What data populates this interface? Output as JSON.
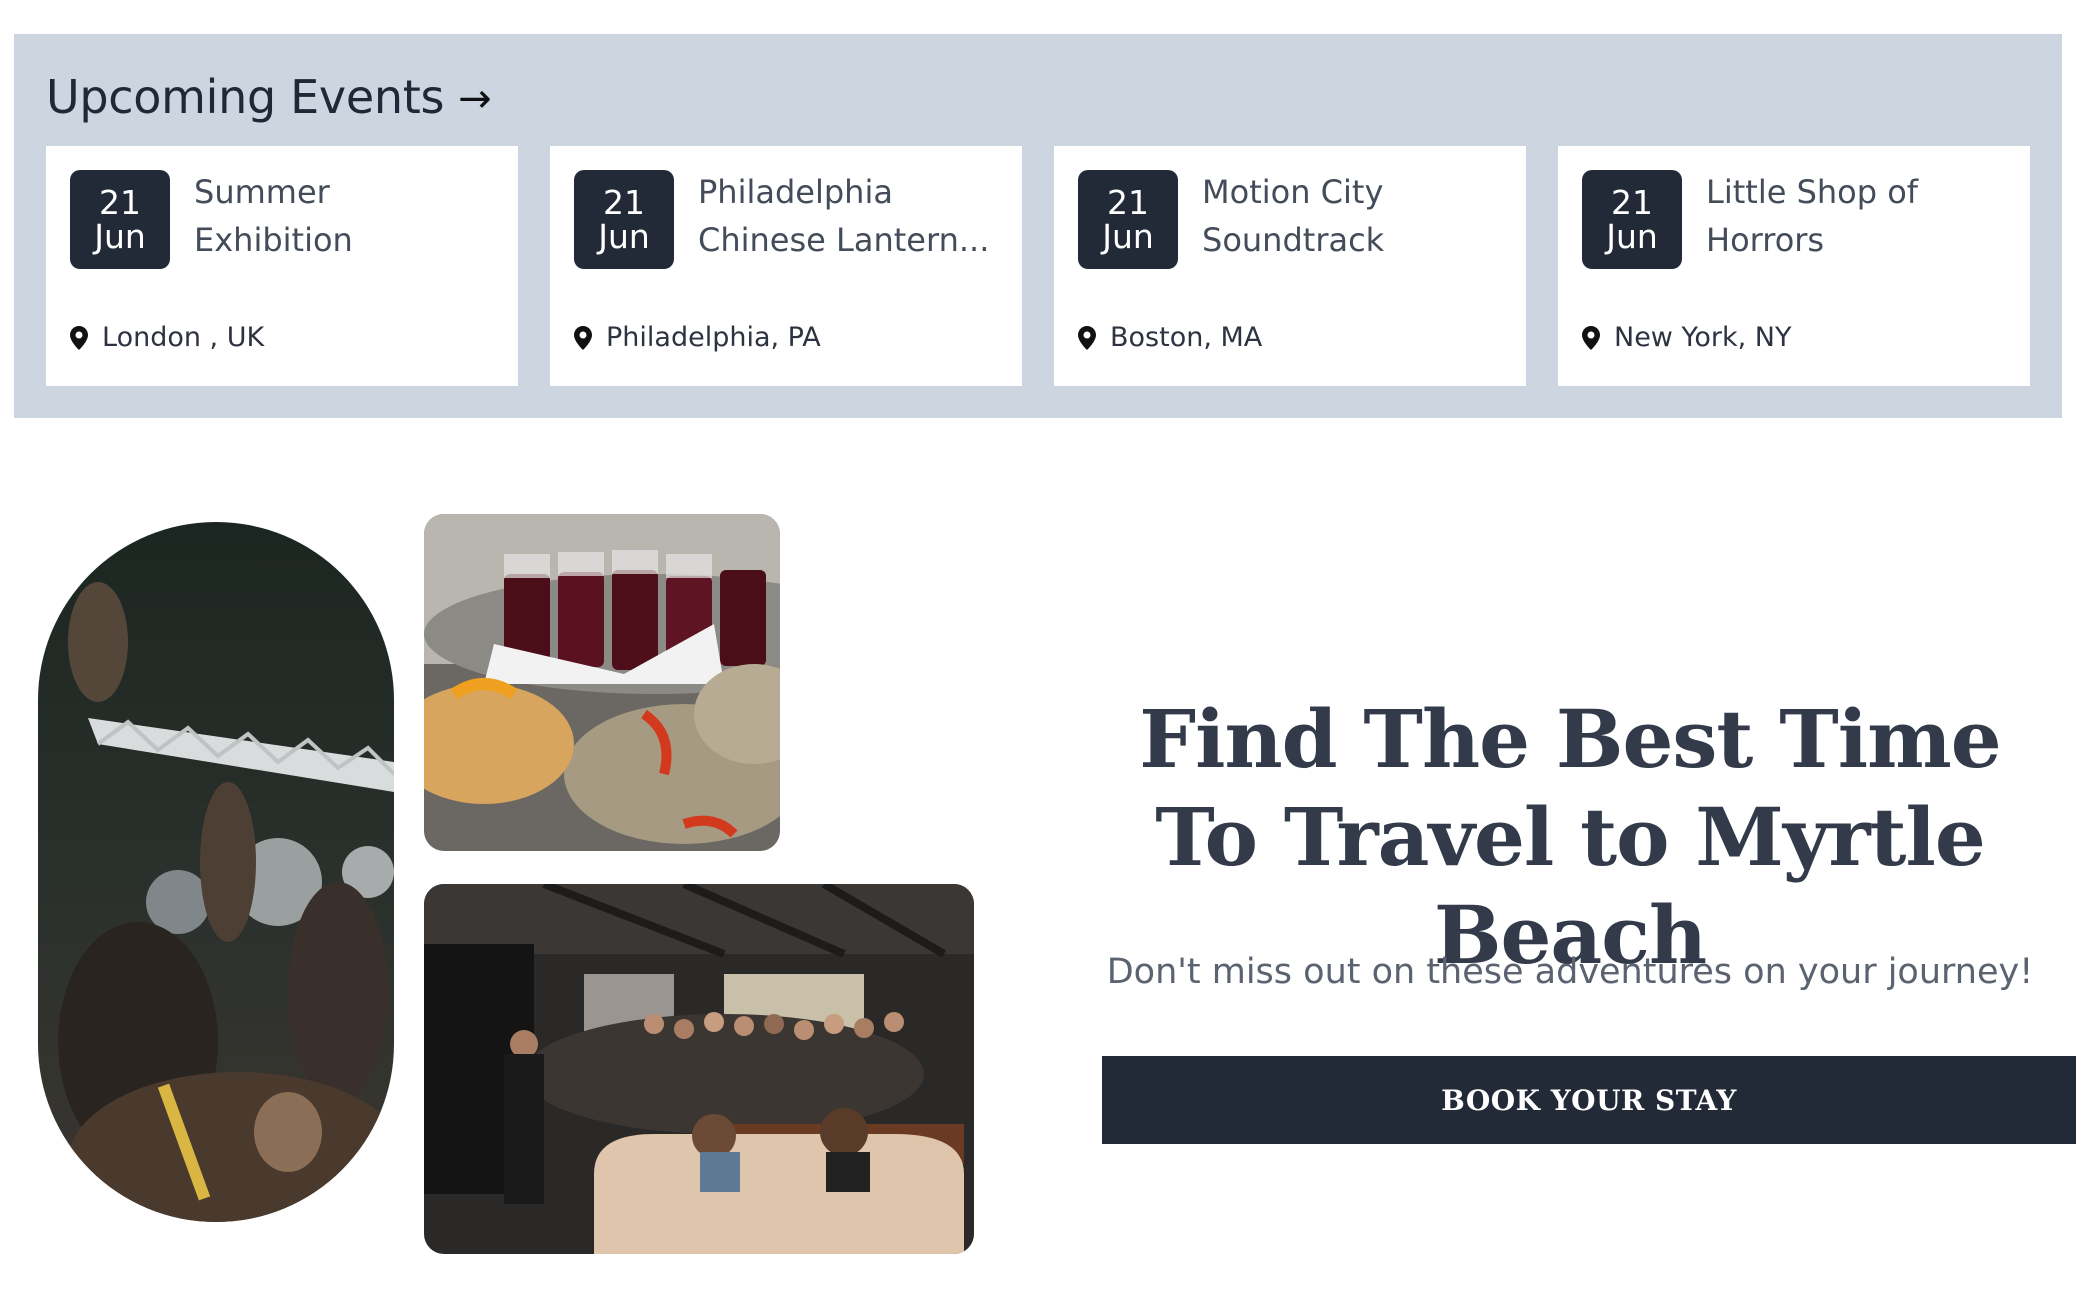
{
  "events": {
    "heading": "Upcoming Events",
    "arrow": "→",
    "items": [
      {
        "day": "21",
        "month": "Jun",
        "title": "Summer Exhibition",
        "location": "London , UK"
      },
      {
        "day": "21",
        "month": "Jun",
        "title": "Philadelphia Chinese Lantern...",
        "location": "Philadelphia, PA"
      },
      {
        "day": "21",
        "month": "Jun",
        "title": "Motion City Soundtrack",
        "location": "Boston, MA"
      },
      {
        "day": "21",
        "month": "Jun",
        "title": "Little Shop of Horrors",
        "location": "New York, NY"
      }
    ]
  },
  "hero": {
    "title": "Find The Best Time To Travel to Myrtle Beach",
    "subtitle": "Don't miss out on these adventures on your journey!",
    "button_label": "BOOK YOUR STAY"
  },
  "colors": {
    "band_background": "#cdd5e1",
    "badge_background": "#222a38",
    "button_background": "#222a38",
    "title_text": "#333b4b"
  },
  "icons": {
    "arrow": "arrow-right-icon",
    "location": "map-pin-icon"
  },
  "images": {
    "left": "party-photo",
    "top_right": "food-drinks-photo",
    "bottom_right": "crowd-gathering-photo"
  }
}
